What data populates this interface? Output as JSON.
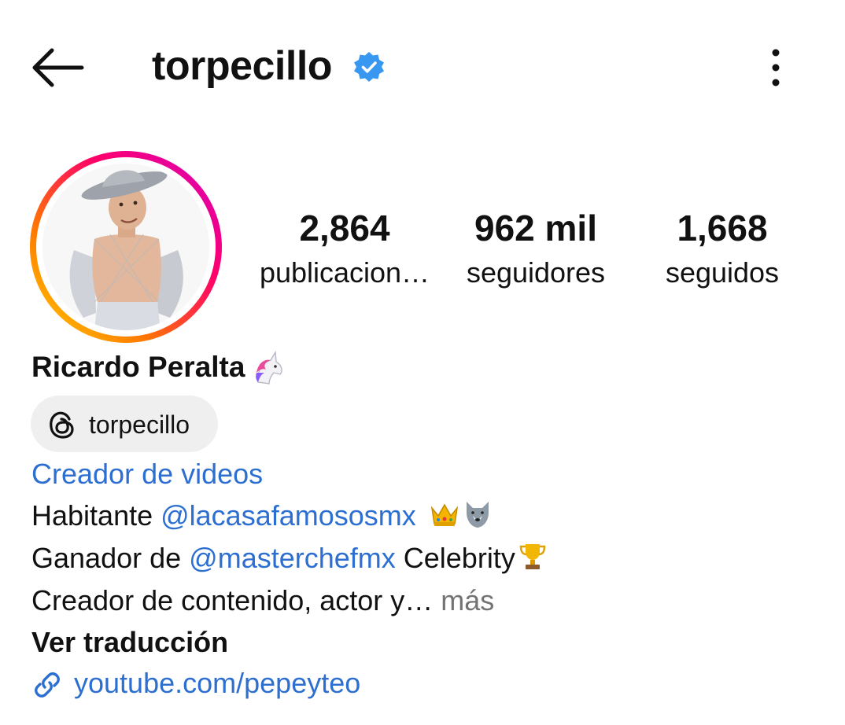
{
  "header": {
    "username": "torpecillo",
    "icons": {
      "back": "arrow-left-icon",
      "verified": "verified-badge-icon",
      "more": "more-vertical-icon"
    }
  },
  "profile": {
    "stats": [
      {
        "value": "2,864",
        "label": "publicacion…"
      },
      {
        "value": "962 mil",
        "label": "seguidores"
      },
      {
        "value": "1,668",
        "label": "seguidos"
      }
    ],
    "full_name": "Ricardo Peralta",
    "name_emoji": "unicorn-emoji",
    "threads_handle": "torpecillo",
    "category": "Creador de videos",
    "bio": {
      "line1_prefix": "Habitante ",
      "line1_mention": "@lacasafamososmx",
      "line2_prefix": "Ganador de ",
      "line2_mention": "@masterchefmx",
      "line2_suffix": " Celebrity",
      "line3_text": "Creador de contenido, actor y…",
      "line3_more": " más"
    },
    "translate_label": "Ver traducción",
    "link": "youtube.com/pepeyteo"
  },
  "colors": {
    "link_blue": "#2d6fd1",
    "verified_blue": "#3897f0",
    "chip_bg": "#efefef",
    "muted": "#737373",
    "ring_gradient": [
      "#d300c5",
      "#ff0069",
      "#ff7a00",
      "#ffd600"
    ]
  }
}
